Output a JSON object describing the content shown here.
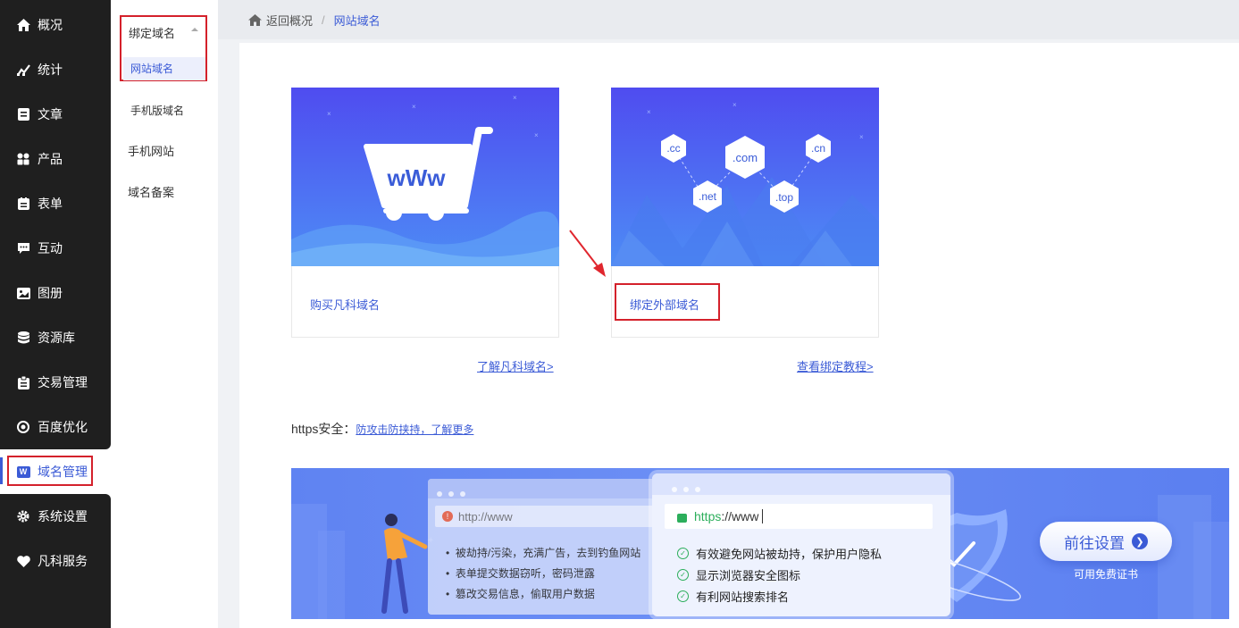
{
  "sidebar": {
    "items": [
      {
        "label": "概况",
        "icon": "home-icon"
      },
      {
        "label": "统计",
        "icon": "chart-icon"
      },
      {
        "label": "文章",
        "icon": "article-icon"
      },
      {
        "label": "产品",
        "icon": "grid-icon"
      },
      {
        "label": "表单",
        "icon": "form-icon"
      },
      {
        "label": "互动",
        "icon": "chat-icon"
      },
      {
        "label": "图册",
        "icon": "album-icon"
      },
      {
        "label": "资源库",
        "icon": "database-icon"
      },
      {
        "label": "交易管理",
        "icon": "clipboard-icon"
      },
      {
        "label": "百度优化",
        "icon": "target-icon"
      },
      {
        "label": "域名管理",
        "icon": "w-badge-icon",
        "badge": "W"
      },
      {
        "label": "系统设置",
        "icon": "gear-icon"
      },
      {
        "label": "凡科服务",
        "icon": "heart-icon"
      }
    ]
  },
  "subnav": {
    "group_label": "绑定域名",
    "active_item": "网站域名",
    "items": [
      "手机版域名",
      "手机网站",
      "域名备案"
    ]
  },
  "breadcrumb": {
    "back": "返回概况",
    "separator": "/",
    "current": "网站域名"
  },
  "cards": {
    "buy": {
      "label": "购买凡科域名",
      "cart_text": "wWw"
    },
    "bind": {
      "label": "绑定外部域名",
      "tags": [
        ".cc",
        ".com",
        ".cn",
        ".net",
        ".top"
      ]
    }
  },
  "links": {
    "learn": "了解凡科域名>",
    "tutorial": "查看绑定教程>"
  },
  "https": {
    "prefix": "https安全：",
    "link": "防攻击防挟持，了解更多"
  },
  "banner": {
    "insecure_url": "http://www",
    "insecure_points": [
      "被劫持/污染，充满广告，去到钓鱼网站",
      "表单提交数据窃听，密码泄露",
      "篡改交易信息，偷取用户数据"
    ],
    "secure_url_https": "https",
    "secure_url_rest": "://www",
    "secure_points": [
      "有效避免网站被劫持，保护用户隐私",
      "显示浏览器安全图标",
      "有利网站搜索排名"
    ],
    "button_label": "前往设置",
    "button_sub": "可用免费证书"
  },
  "colors": {
    "accent": "#3b5bd6",
    "nav_bg": "#1f1f1f",
    "highlight": "#d4212b"
  }
}
